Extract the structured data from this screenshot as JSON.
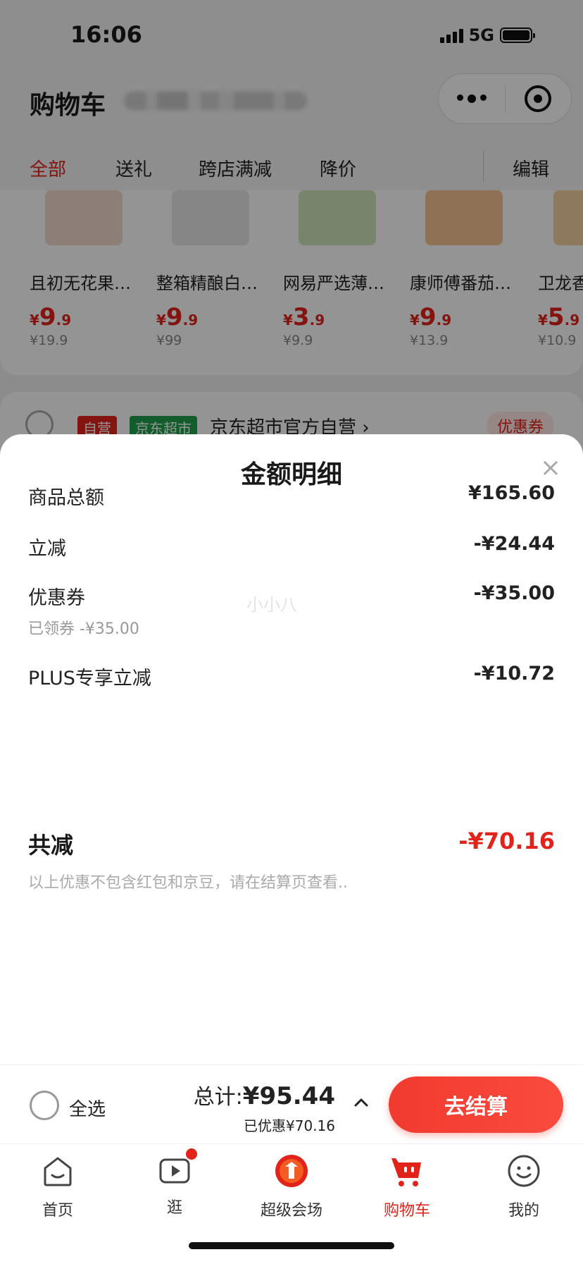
{
  "status_bar": {
    "time": "16:06",
    "network": "5G"
  },
  "header": {
    "title": "购物车"
  },
  "tabs": [
    {
      "label": "全部",
      "active": true
    },
    {
      "label": "送礼",
      "active": false
    },
    {
      "label": "跨店满减",
      "active": false
    },
    {
      "label": "降价",
      "active": false
    },
    {
      "label": "编辑",
      "active": false
    }
  ],
  "products": [
    {
      "name": "且初无花果…",
      "price_int": "9",
      "price_dec": ".9",
      "orig": "¥19.9",
      "img_color": "#f3d9cf"
    },
    {
      "name": "整箱精酿白…",
      "price_int": "9",
      "price_dec": ".9",
      "orig": "¥99",
      "img_color": "#e7e7e7"
    },
    {
      "name": "网易严选薄…",
      "price_int": "3",
      "price_dec": ".9",
      "orig": "¥9.9",
      "img_color": "#cfe3b8"
    },
    {
      "name": "康师傅番茄…",
      "price_int": "9",
      "price_dec": ".9",
      "orig": "¥13.9",
      "img_color": "#f6c493"
    },
    {
      "name": "卫龙香…",
      "price_int": "5",
      "price_dec": ".9",
      "orig": "¥10.9",
      "img_color": "#f3d3a2"
    }
  ],
  "shop": {
    "badge_ziying": "自营",
    "badge_chaoshi": "京东超市",
    "name": "京东超市官方自营 ›",
    "coupon": "优惠券"
  },
  "sheet": {
    "title": "金额明细",
    "close": "×",
    "watermark": "小小八",
    "rows": [
      {
        "label": "商品总额",
        "value": "¥165.60"
      },
      {
        "label": "立减",
        "value": "-¥24.44"
      },
      {
        "label": "优惠券",
        "value": "-¥35.00",
        "sub": "已领券 -¥35.00"
      },
      {
        "label": "PLUS专享立减",
        "value": "-¥10.72"
      }
    ],
    "total_label": "共减",
    "total_value": "-¥70.16",
    "note": "以上优惠不包含红包和京豆，请在结算页查看.."
  },
  "checkout": {
    "select_all": "全选",
    "sum_label": "总计:",
    "sum_value": "¥95.44",
    "saved": "已优惠¥70.16",
    "pay_button": "去结算"
  },
  "tabbar": [
    {
      "label": "首页",
      "icon": "home-icon"
    },
    {
      "label": "逛",
      "icon": "video-play-icon"
    },
    {
      "label": "超级会场",
      "icon": "super-venue-icon"
    },
    {
      "label": "购物车",
      "icon": "cart-icon",
      "active": true
    },
    {
      "label": "我的",
      "icon": "profile-icon"
    }
  ],
  "colors": {
    "accent": "#e2231a",
    "green_badge": "#1fa04a"
  }
}
